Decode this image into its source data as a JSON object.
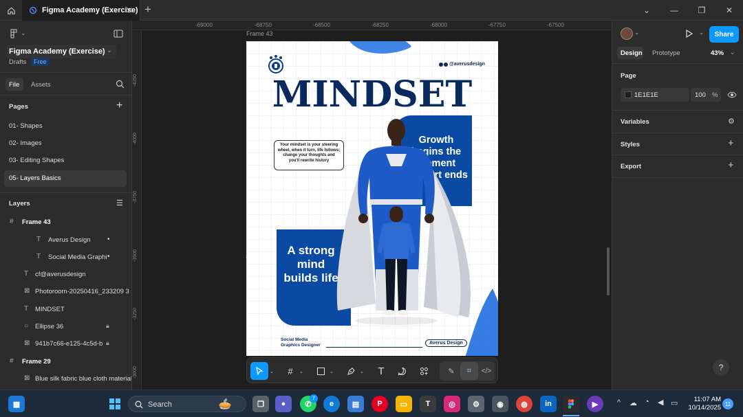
{
  "titlebar": {
    "tab_title": "Figma Academy (Exercise)"
  },
  "left_panel": {
    "file_name": "Figma Academy (Exercise)",
    "location": "Drafts",
    "plan_badge": "Free",
    "tabs": [
      {
        "label": "File"
      },
      {
        "label": "Assets"
      }
    ],
    "pages_title": "Pages",
    "pages": [
      {
        "label": "01- Shapes"
      },
      {
        "label": "02- Images"
      },
      {
        "label": "03- Editing Shapes"
      },
      {
        "label": "05- Layers Basics"
      }
    ],
    "layers_title": "Layers",
    "layers": [
      {
        "label": "Frame 43"
      },
      {
        "label": "Averus Design"
      },
      {
        "label": "Social Media Graphi"
      },
      {
        "label": "cf@averusdesign"
      },
      {
        "label": "Photoroom-20250416_233209 3"
      },
      {
        "label": "MINDSET"
      },
      {
        "label": "Ellipse 36"
      },
      {
        "label": "941b7c66-e125-4c5d-b"
      },
      {
        "label": "Frame 29"
      },
      {
        "label": "Blue silk fabric blue cloth material"
      }
    ]
  },
  "canvas": {
    "ruler_top": [
      "-69000",
      "-68750",
      "-68500",
      "-68250",
      "-68000",
      "-67750",
      "-67500"
    ],
    "ruler_left": [
      "-4250",
      "-4000",
      "-3750",
      "-3500",
      "-3250",
      "-3000"
    ],
    "frame_label": "Frame 43"
  },
  "poster": {
    "handle": "@averusdesign",
    "headline": "MINDSET",
    "bubble_text": "Your mindset is your steering wheel, when it turn, life follows; change your thoughts and you'll rewrite history",
    "right_block": "Growth begins the moment comfort ends",
    "left_block": "A strong mind builds life",
    "footer_left_line1": "Social Media",
    "footer_left_line2": "Graphics Designer",
    "footer_right": "Averus Design"
  },
  "right_panel": {
    "avatar_label": "User",
    "share_label": "Share",
    "tabs": [
      {
        "label": "Design"
      },
      {
        "label": "Prototype"
      }
    ],
    "zoom": "43%",
    "page_section": "Page",
    "page_color": "1E1E1E",
    "page_opacity": "100",
    "percent": "%",
    "variables": "Variables",
    "styles": "Styles",
    "export": "Export",
    "help": "?"
  },
  "taskbar": {
    "search_label": "Search",
    "time": "11:07 AM",
    "date": "10/14/2025",
    "notification_count": "11",
    "whatsapp_badge": "7"
  },
  "colors": {
    "accent": "#0d99ff",
    "poster_blue": "#0b4aa2",
    "navy": "#0a2a5e"
  }
}
